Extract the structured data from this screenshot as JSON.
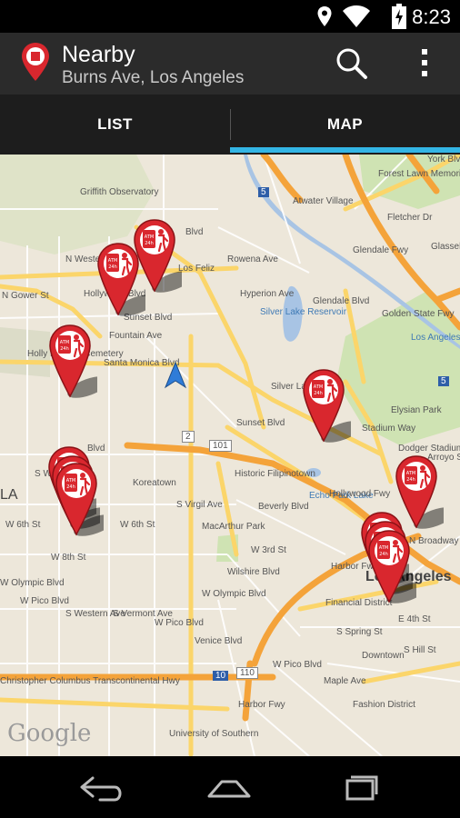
{
  "status_bar": {
    "time": "8:23",
    "icons": [
      "location-icon",
      "wifi-icon",
      "battery-icon"
    ]
  },
  "action_bar": {
    "title": "Nearby",
    "subtitle": "Burns Ave, Los Angeles",
    "icons": [
      "app-logo-icon",
      "search-icon",
      "overflow-menu-icon"
    ]
  },
  "tabs": [
    {
      "label": "LIST",
      "selected": false
    },
    {
      "label": "MAP",
      "selected": true
    }
  ],
  "colors": {
    "accent": "#33b5e5",
    "marker_red": "#d9272e",
    "action_bar": "#2b2b2b"
  },
  "map": {
    "attribution": "Google",
    "marker_badge": "ATM 24h",
    "labels": {
      "griffith": "Griffith Observatory",
      "forest_lawn": "Forest Lawn Memorial Park",
      "atwater": "Atwater Village",
      "los_feliz": "Los Feliz",
      "hollywood_blvd": "Hollywood Blvd",
      "sunset_blvd": "Sunset Blvd",
      "fountain_ave": "Fountain Ave",
      "santa_monica_blvd": "Santa Monica Blvd",
      "hollywood_forever": "Holly Forever Cemetery",
      "silver_lake_res": "Silver Lake Reservoir",
      "silver_lake": "Silver Lake",
      "sunset_blvd2": "Sunset Blvd",
      "glendale_fwy": "Glendale Fwy",
      "golden_state_fwy": "Golden State Fwy",
      "los_angeles_river": "Los Angeles River",
      "elysian_park": "Elysian Park",
      "dodger_stadium": "Dodger Stadium",
      "echo_park_lake": "Echo Park Lake",
      "historic_filipinotown": "Historic Filipinotown",
      "koreatown": "Koreatown",
      "macarthur_park": "MacArthur Park",
      "beverly_blvd": "Beverly Blvd",
      "w_3rd_st": "W 3rd St",
      "w_6th_st": "W 6th St",
      "w_6th_st2": "W 6th St",
      "wilshire_blvd": "Wilshire Blvd",
      "w_8th_st": "W 8th St",
      "w_olympic_blvd": "W Olympic Blvd",
      "w_olympic_blvd2": "W Olympic Blvd",
      "w_pico_blvd": "W Pico Blvd",
      "w_pico_blvd2": "W Pico Blvd",
      "venice_blvd": "Venice Blvd",
      "los_angeles": "Los Angeles",
      "financial_district": "Financial District",
      "downtown": "Downtown",
      "fashion_district": "Fashion District",
      "university": "University of Southern",
      "columbus_hwy": "Christopher Columbus Transcontinental Hwy",
      "hollywood_fwy": "Hollywood Fwy",
      "harbor_fwy": "Harbor Fwy",
      "harbor_fwy2": "Harbor Fwy",
      "n_western_ave": "N Western Ave",
      "s_western_ave": "S Western Ave",
      "s_vermont_ave": "S Vermont Ave",
      "s_virgil_ave": "S Virgil Ave",
      "n_gower_st": "N Gower St",
      "s_wilton_pl": "S Wilton Pl",
      "la": "LA",
      "w_5th_blvd": "W 6th St",
      "rowena_ave": "Rowena Ave",
      "hyperion_ave": "Hyperion Ave",
      "glendale_blvd": "Glendale Blvd",
      "fletcher_dr": "Fletcher Dr",
      "stadium_way": "Stadium Way",
      "n_broadway": "N Broadway",
      "s_spring_st": "S Spring St",
      "maple_ave": "Maple Ave",
      "w_pico_blvd3": "W Pico Blvd",
      "hwy_2": "2",
      "hwy_101": "101",
      "hwy_5": "5",
      "hwy_5b": "5",
      "hwy_10": "10",
      "hwy_110": "110",
      "glassell_park": "Glassell Park",
      "york_blvd": "York Blvd",
      "blvd": "Blvd",
      "hollywood_blvd2": "Blvd",
      "arroyo": "Arroyo Seco Pkwy",
      "w_4th_st": "E 4th St",
      "hill_st": "S Hill St",
      "w_venice": "W Venice Blvd"
    }
  }
}
